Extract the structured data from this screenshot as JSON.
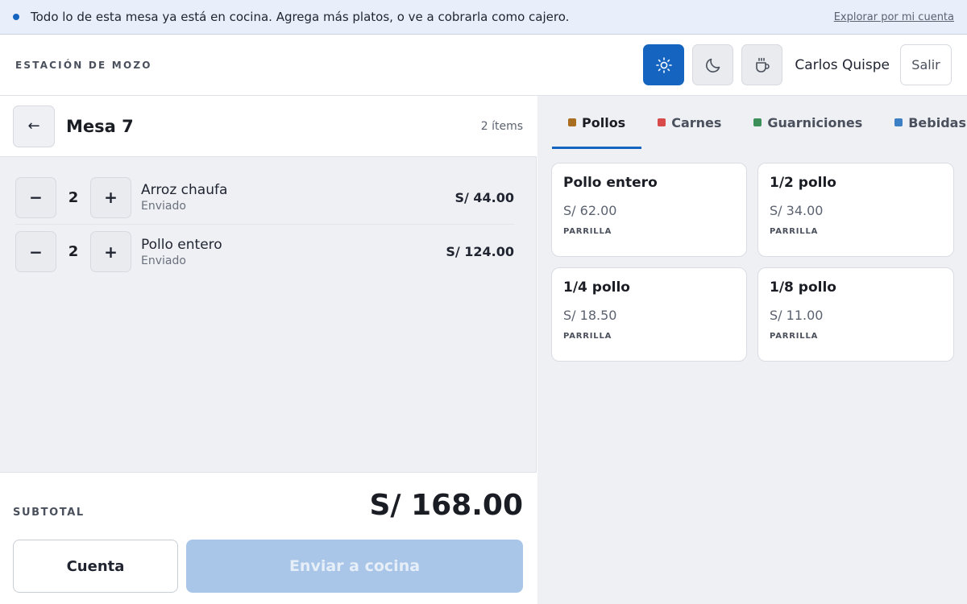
{
  "banner": {
    "message": "Todo lo de esta mesa ya está en cocina. Agrega más platos, o ve a cobrarla como cajero.",
    "link": "Explorar por mi cuenta",
    "dot_color": "#1565c0"
  },
  "header": {
    "title": "ESTACIÓN DE MOZO",
    "theme_buttons": [
      {
        "icon": "sun-icon",
        "active": true
      },
      {
        "icon": "moon-icon",
        "active": false
      },
      {
        "icon": "coffee-icon",
        "active": false
      }
    ],
    "user_name": "Carlos Quispe",
    "logout_label": "Salir"
  },
  "order": {
    "back_label": "←",
    "table_name": "Mesa 7",
    "items_count": "2 ítems",
    "items": [
      {
        "qty": "2",
        "name": "Arroz chaufa",
        "status": "Enviado",
        "price": "S/ 44.00"
      },
      {
        "qty": "2",
        "name": "Pollo entero",
        "status": "Enviado",
        "price": "S/ 124.00"
      }
    ],
    "decrement_label": "−",
    "increment_label": "+",
    "subtotal_label": "SUBTOTAL",
    "subtotal_value": "S/ 168.00",
    "account_label": "Cuenta",
    "send_label": "Enviar a cocina"
  },
  "menu": {
    "tabs": [
      {
        "label": "Pollos",
        "color": "#a86d1f",
        "active": true
      },
      {
        "label": "Carnes",
        "color": "#d94a4a",
        "active": false
      },
      {
        "label": "Guarniciones",
        "color": "#3d8f5a",
        "active": false
      },
      {
        "label": "Bebidas",
        "color": "#3d7fc4",
        "active": false
      }
    ],
    "products": [
      {
        "name": "Pollo entero",
        "price": "S/ 62.00",
        "tag": "PARRILLA"
      },
      {
        "name": "1/2 pollo",
        "price": "S/ 34.00",
        "tag": "PARRILLA"
      },
      {
        "name": "1/4 pollo",
        "price": "S/ 18.50",
        "tag": "PARRILLA"
      },
      {
        "name": "1/8 pollo",
        "price": "S/ 11.00",
        "tag": "PARRILLA"
      }
    ]
  },
  "colors": {
    "accent": "#1565c0",
    "send_disabled": "#a9c6e8"
  }
}
